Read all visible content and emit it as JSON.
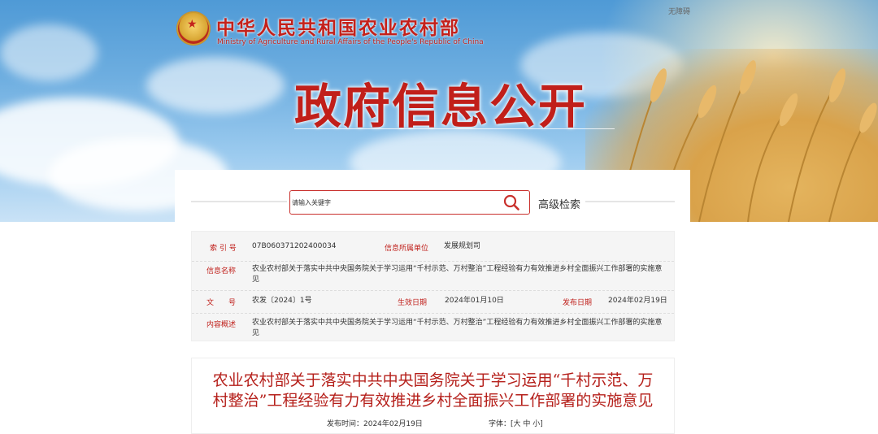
{
  "header": {
    "site_name": "中华人民共和国农业农村部",
    "site_name_en": "Ministry of Agriculture and Rural Affairs of the People's Republic of China",
    "accessibility_link": "无障碍",
    "banner_title": "政府信息公开"
  },
  "search": {
    "placeholder": "请输入关键字",
    "advanced_label": "高级检索"
  },
  "info": {
    "index_label": "索 引 号",
    "index_value": "07B060371202400034",
    "unit_label": "信息所属单位",
    "unit_value": "发展规划司",
    "name_label": "信息名称",
    "name_value": "农业农村部关于落实中共中央国务院关于学习运用“千村示范、万村整治”工程经验有力有效推进乡村全面振兴工作部署的实施意见",
    "doc_label": "文　　号",
    "doc_value": "农发〔2024〕1号",
    "effective_label": "生效日期",
    "effective_value": "2024年01月10日",
    "publish_label": "发布日期",
    "publish_value": "2024年02月19日",
    "summary_label": "内容概述",
    "summary_value": "农业农村部关于落实中共中央国务院关于学习运用“千村示范、万村整治”工程经验有力有效推进乡村全面振兴工作部署的实施意见"
  },
  "article": {
    "title": "农业农村部关于落实中共中央国务院关于学习运用“千村示范、万村整治”工程经验有力有效推进乡村全面振兴工作部署的实施意见",
    "publish_time": "发布时间：2024年02月19日",
    "font_size_label": "字体：[大 中 小]"
  },
  "colors": {
    "brand_red": "#c4211b",
    "label_red": "#c0201b"
  }
}
